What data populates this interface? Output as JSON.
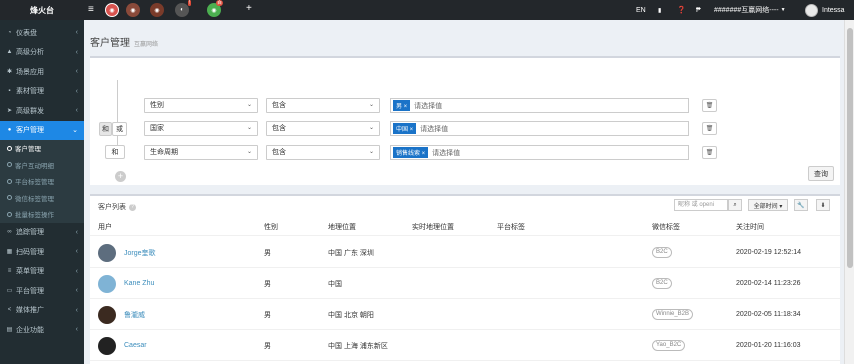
{
  "brand": "烽火台",
  "header": {
    "lang": "EN",
    "account": "#######互赢网络----",
    "user": "Intessa",
    "badges": [
      "!",
      "百"
    ]
  },
  "sidebar": {
    "items": [
      {
        "icon": "dashboard-icon",
        "glyph": "◔",
        "label": "仪表盘"
      },
      {
        "icon": "chart-icon",
        "glyph": "▲",
        "label": "高级分析"
      },
      {
        "icon": "cog-icon",
        "glyph": "✱",
        "label": "场景应用"
      },
      {
        "icon": "folder-icon",
        "glyph": "▪",
        "label": "素材管理"
      },
      {
        "icon": "send-icon",
        "glyph": "➤",
        "label": "高级群发"
      },
      {
        "icon": "user-icon",
        "glyph": "●",
        "label": "客户管理"
      }
    ],
    "subitems": [
      "客户管理",
      "客户互动明细",
      "平台标签管理",
      "微信标签管理",
      "批量标签操作"
    ],
    "bottom": [
      {
        "icon": "link-icon",
        "glyph": "∞",
        "label": "追踪管理"
      },
      {
        "icon": "qrcode-icon",
        "glyph": "▦",
        "label": "扫码管理"
      },
      {
        "icon": "menu-icon",
        "glyph": "≡",
        "label": "菜单管理"
      },
      {
        "icon": "desktop-icon",
        "glyph": "▭",
        "label": "平台管理"
      },
      {
        "icon": "share-icon",
        "glyph": "<",
        "label": "媒体推广"
      },
      {
        "icon": "building-icon",
        "glyph": "▤",
        "label": "企业功能"
      }
    ]
  },
  "page": {
    "title": "客户管理",
    "subtitle": "互赢网络"
  },
  "filter": {
    "logic_and": "和",
    "logic_or": "或",
    "operator": "包含",
    "placeholder": "请选择值",
    "rows": [
      {
        "field": "性别",
        "tag": "男 ×"
      },
      {
        "field": "国家",
        "tag": "中国 ×"
      },
      {
        "field": "生命周期",
        "tag": "销售线索 ×"
      }
    ],
    "query": "查询"
  },
  "list": {
    "title": "客户列表",
    "search_placeholder": "昵称 或 openi",
    "time_filter": "全部时间 ▾",
    "columns": [
      "用户",
      "性别",
      "地理位置",
      "实时地理位置",
      "平台标签",
      "微信标签",
      "关注时间"
    ],
    "rows": [
      {
        "name": "Jorge奎歌",
        "gender": "男",
        "location": "中国 广东 深圳",
        "rt": "",
        "ptag": "",
        "wtag": "B2C",
        "time": "2020-02-19 12:52:14"
      },
      {
        "name": "Kane Zhu",
        "gender": "男",
        "location": "中国",
        "rt": "",
        "ptag": "",
        "wtag": "B2C",
        "time": "2020-02-14 11:23:26"
      },
      {
        "name": "鲁瀧威",
        "gender": "男",
        "location": "中国 北京 朝阳",
        "rt": "",
        "ptag": "",
        "wtag": "Winnie_B2B",
        "time": "2020-02-05 11:18:34"
      },
      {
        "name": "Caesar",
        "gender": "男",
        "location": "中国 上海 浦东新区",
        "rt": "",
        "ptag": "",
        "wtag": "Yao_B2C",
        "time": "2020-01-20 11:16:03"
      }
    ]
  },
  "colors": {
    "topbar": "#23272b",
    "sidebar": "#222d32",
    "accent": "#1e88e5",
    "tag": "#1a73c8"
  }
}
